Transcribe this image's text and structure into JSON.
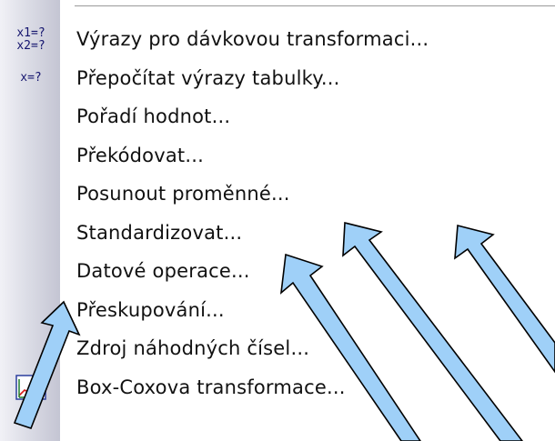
{
  "menu": {
    "items": [
      {
        "label": "Výrazy pro dávkovou transformaci...",
        "icon": "batch-expressions-icon",
        "icon_text_1": "x1=?",
        "icon_text_2": "x2=?"
      },
      {
        "label": "Přepočítat výrazy tabulky...",
        "icon": "recalculate-expressions-icon",
        "icon_text_1": "x=?"
      },
      {
        "label": "Pořadí hodnot..."
      },
      {
        "label": "Překódovat..."
      },
      {
        "label": "Posunout proměnné..."
      },
      {
        "label": "Standardizovat..."
      },
      {
        "label": "Datové operace..."
      },
      {
        "label": "Přeskupování..."
      },
      {
        "label": "Zdroj náhodných čísel..."
      },
      {
        "label": "Box-Coxova transformace...",
        "icon": "box-cox-chart-icon"
      }
    ]
  },
  "colors": {
    "arrow_fill": "#9fd0f8",
    "arrow_stroke": "#000000",
    "icon_strip": "#d6d7e2"
  }
}
